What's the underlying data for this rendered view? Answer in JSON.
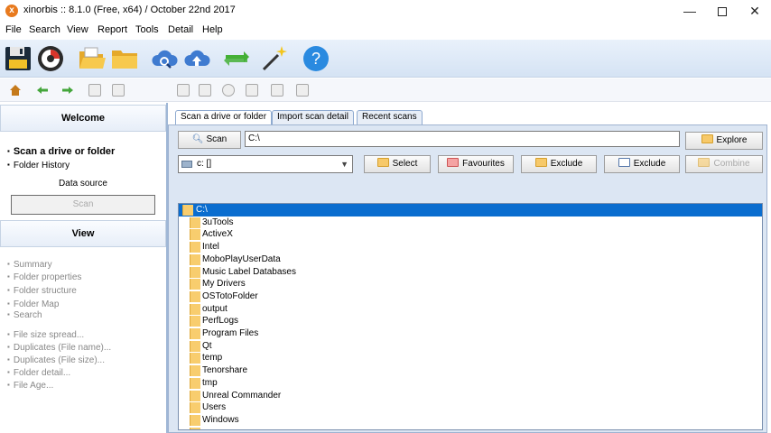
{
  "window": {
    "title": "xinorbis :: 8.1.0 (Free, x64) / October 22nd 2017",
    "app_icon_glyph": "x",
    "minimize_glyph": "—",
    "close_glyph": "✕"
  },
  "menu": [
    "File",
    "Search",
    "View",
    "Report",
    "Tools",
    "Detail",
    "Help"
  ],
  "colors": {
    "accent": "#0a6dcf",
    "folder": "#f8cd6e",
    "panel_bg": "#dce6f3"
  },
  "big_toolbar_icons": [
    "save-icon",
    "settings-dial-icon",
    "open-folder-icon",
    "folder-icon",
    "cloud-search-icon",
    "cloud-upload-icon",
    "sync-icon",
    "magic-wand-icon",
    "help-icon"
  ],
  "small_toolbar_icons": [
    "home-icon",
    "back-arrow-icon",
    "forward-arrow-icon",
    "lock-icon",
    "stop-icon",
    "report-icon",
    "chart-icon",
    "globe-icon",
    "edit-icon",
    "ghost-icon",
    "export-icon"
  ],
  "sidebar": {
    "welcome_header": "Welcome",
    "scan_drive_link": "Scan a drive or folder",
    "folder_history_link": "Folder History",
    "data_source_label": "Data source",
    "scan_button": "Scan",
    "view_header": "View",
    "view_links": [
      "Summary",
      "Folder properties",
      "Folder structure",
      "Folder Map",
      "Search"
    ],
    "analysis_links": [
      "File size spread...",
      "Duplicates (File name)...",
      "Duplicates (File size)...",
      "Folder detail...",
      "File Age..."
    ]
  },
  "tabs": [
    "Scan a drive or folder",
    "Import scan detail",
    "Recent scans"
  ],
  "scan_panel": {
    "scan_button": "Scan",
    "path_value": "C:\\",
    "explore_button": "Explore",
    "drive_select_value": "c: []",
    "select_button": "Select",
    "favourites_button": "Favourites",
    "exclude_button_1": "Exclude",
    "exclude_button_2": "Exclude",
    "combine_button": "Combine"
  },
  "tree": {
    "root": "C:\\",
    "folders": [
      "3uTools",
      "ActiveX",
      "Intel",
      "MoboPlayUserData",
      "Music Label Databases",
      "My Drivers",
      "OSTotoFolder",
      "output",
      "PerfLogs",
      "Program Files",
      "Qt",
      "temp",
      "Tenorshare",
      "tmp",
      "Unreal Commander",
      "Users",
      "Windows",
      "xampp"
    ]
  }
}
